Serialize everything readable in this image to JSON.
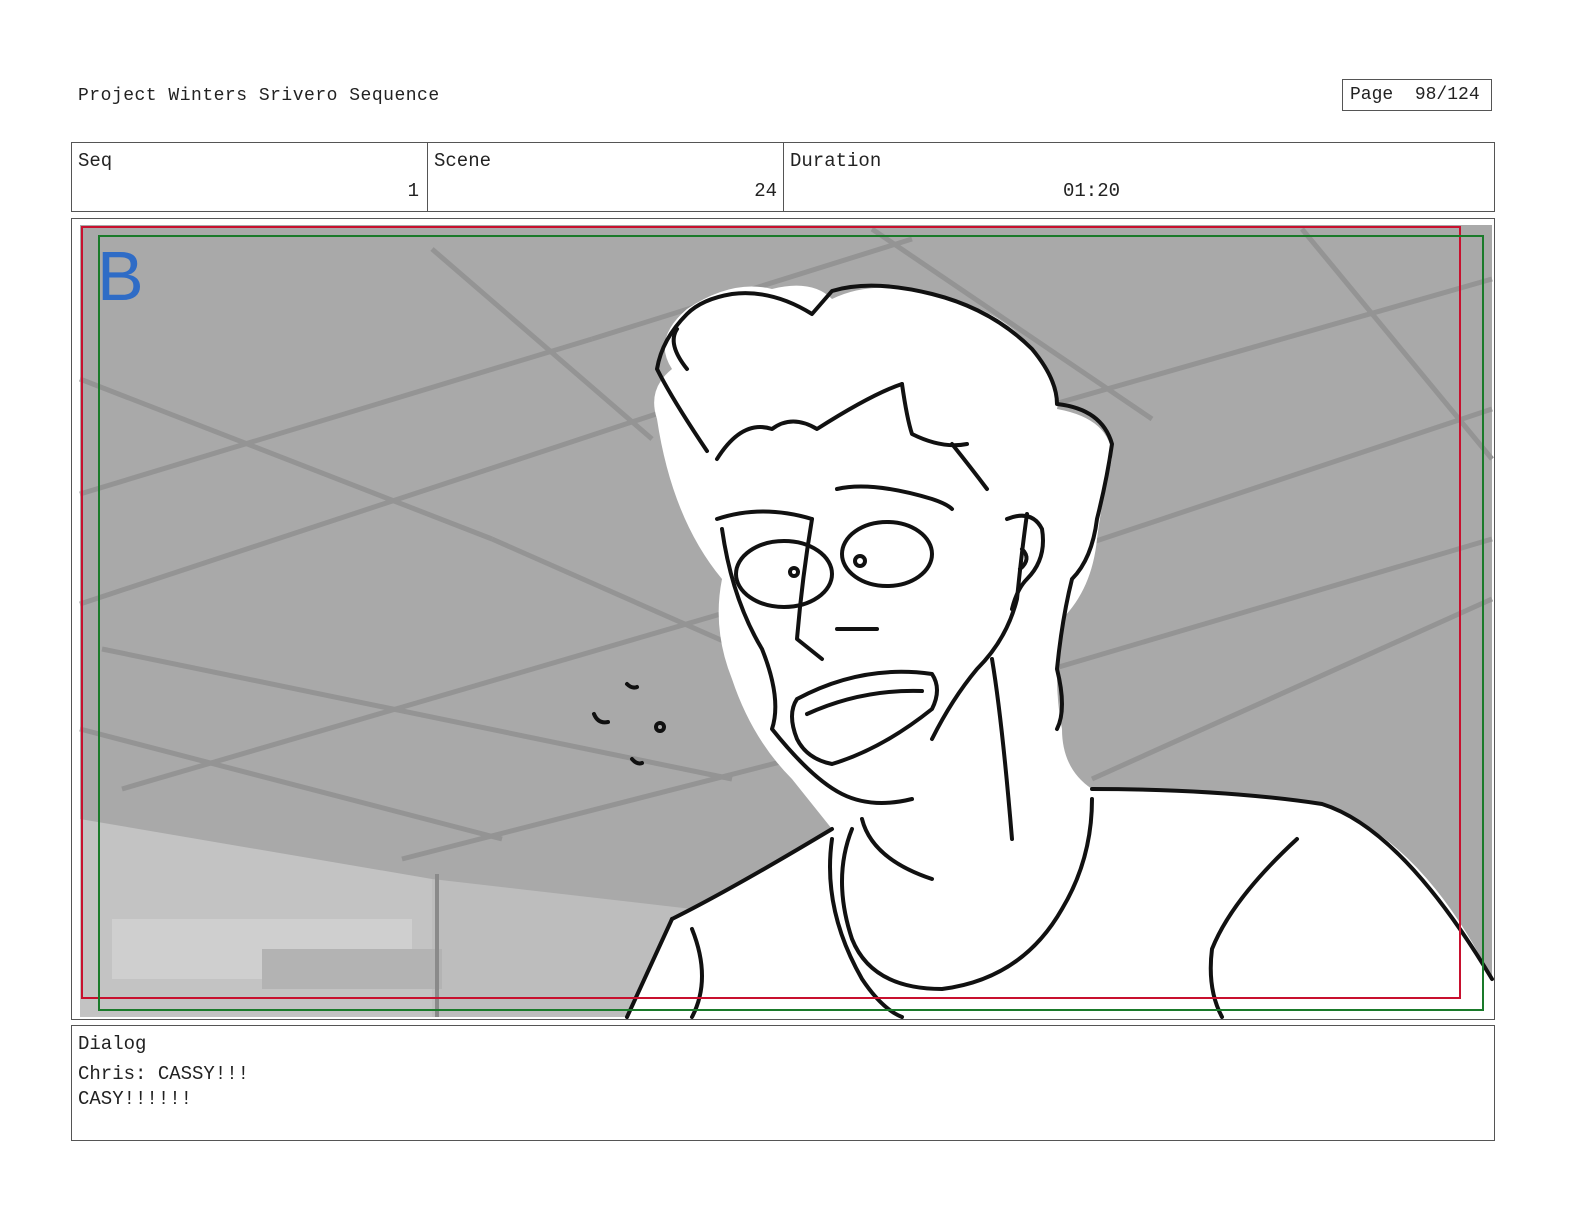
{
  "header": {
    "project_title": "Project Winters Srivero Sequence",
    "page_label": "Page",
    "page_number": "98/124"
  },
  "info": {
    "seq_label": "Seq",
    "seq_value": "1",
    "scene_label": "Scene",
    "scene_value": "24",
    "duration_label": "Duration",
    "duration_value": "01:20"
  },
  "panel": {
    "letter": "B",
    "letter_color": "#2f6cc6",
    "safe_frame_red": "#c8102e",
    "safe_frame_green": "#1a7a2a"
  },
  "dialog": {
    "label": "Dialog",
    "lines": [
      "Chris: CASSY!!!",
      "CASY!!!!!!"
    ]
  }
}
